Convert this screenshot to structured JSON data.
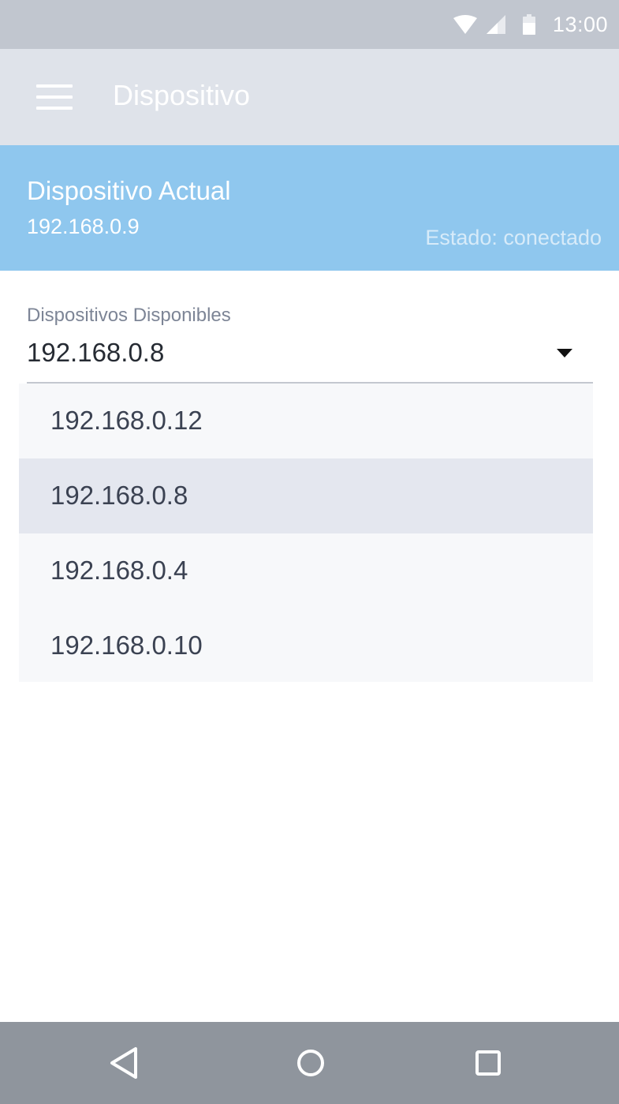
{
  "status_bar": {
    "time": "13:00",
    "icons": [
      "wifi-icon",
      "signal-icon",
      "battery-icon"
    ]
  },
  "app_bar": {
    "title": "Dispositivo",
    "menu_icon": "menu-icon"
  },
  "current_device": {
    "title": "Dispositivo Actual",
    "ip": "192.168.0.9",
    "status": "Estado: conectado"
  },
  "device_select": {
    "label": "Dispositivos Disponibles",
    "value": "192.168.0.8",
    "options": [
      {
        "label": "192.168.0.12",
        "selected": false
      },
      {
        "label": "192.168.0.8",
        "selected": true
      },
      {
        "label": "192.168.0.4",
        "selected": false
      },
      {
        "label": "192.168.0.10",
        "selected": false
      }
    ]
  },
  "nav_bar": {
    "buttons": [
      "back-icon",
      "home-icon",
      "recents-icon"
    ]
  },
  "colors": {
    "status_bar": "#c1c6cf",
    "app_bar": "#dfe3ea",
    "accent_panel": "#8fc7ee",
    "nav_bar": "#8f959d",
    "selected_item": "#e4e7ef"
  }
}
